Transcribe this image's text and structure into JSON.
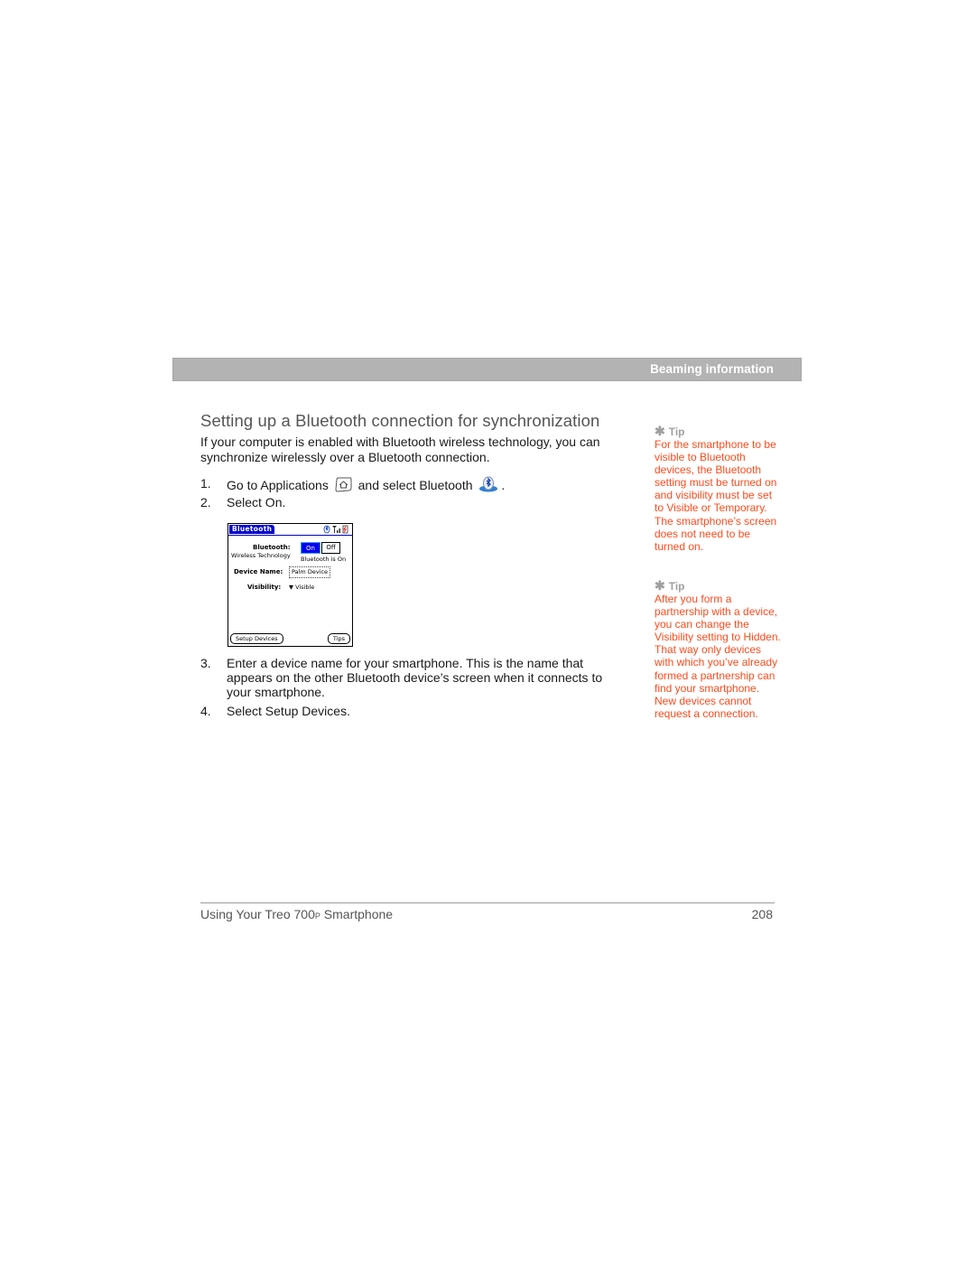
{
  "header": {
    "section": "Beaming information"
  },
  "main": {
    "title": "Setting up a Bluetooth connection for synchronization",
    "intro": "If your computer is enabled with Bluetooth wireless technology, you can synchronize wirelessly over a Bluetooth connection.",
    "steps": [
      {
        "num": "1.",
        "before": "Go to Applications",
        "icon1": "applications-icon",
        "middle": "and select Bluetooth",
        "icon2": "bluetooth-app-icon",
        "after": "."
      },
      {
        "num": "2.",
        "text": "Select On."
      },
      {
        "num": "3.",
        "text": "Enter a device name for your smartphone. This is the name that appears on the other Bluetooth device’s screen when it connects to your smartphone."
      },
      {
        "num": "4.",
        "text": "Select Setup Devices."
      }
    ]
  },
  "palm_screen": {
    "title": "Bluetooth",
    "status_icons": [
      "bluetooth-status-icon",
      "signal-icon",
      "battery-icon"
    ],
    "bluetooth_label": "Bluetooth:",
    "wireless_label": "Wireless Technology",
    "on_label": "On",
    "off_label": "Off",
    "status_text": "Bluetooth is On",
    "device_name_label": "Device Name:",
    "device_name_value": "Palm Device",
    "visibility_label": "Visibility:",
    "visibility_value": "Visible",
    "setup_devices_button": "Setup Devices",
    "tips_button": "Tips",
    "selected": "On"
  },
  "tips": [
    {
      "label": "Tip",
      "icon": "asterisk-icon",
      "text": "For the smartphone to be visible to Bluetooth devices, the Bluetooth setting must be turned on and visibility must be set to Visible or Temporary. The smartphone’s screen does not need to be turned on."
    },
    {
      "label": "Tip",
      "icon": "asterisk-icon",
      "text": "After you form a partnership with a device, you can change the Visibility setting to Hidden. That way only devices with which you’ve already formed a partnership can find your smartphone. New devices cannot request a connection."
    }
  ],
  "footer": {
    "title_prefix": "Using Your Treo 700",
    "title_model_suffix": "P",
    "title_suffix": " Smartphone",
    "page_number": "208"
  },
  "colors": {
    "tip_text": "#ff4a1c",
    "section_bar": "#b3b3b3",
    "palm_highlight": "#0000ee"
  }
}
